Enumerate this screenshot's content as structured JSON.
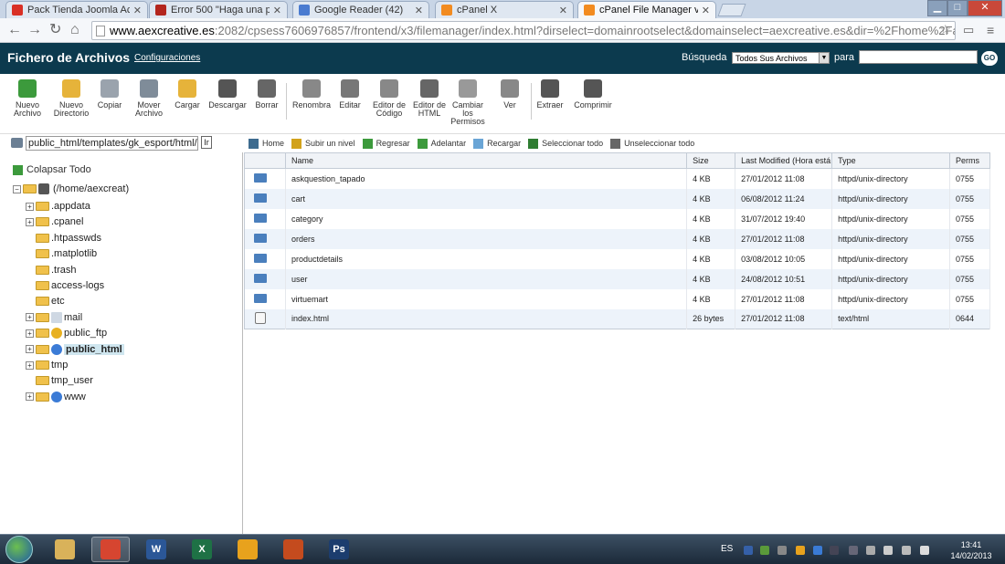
{
  "browser": {
    "tabs": [
      {
        "title": "Pack Tienda Joomla Activ",
        "icon": "gmail-icon",
        "active": false
      },
      {
        "title": "Error 500 \"Haga una pregu",
        "icon": "foro-icon",
        "active": false
      },
      {
        "title": "Google Reader (42)",
        "icon": "reader-icon",
        "active": false
      },
      {
        "title": "cPanel X",
        "icon": "cpanel-icon",
        "active": false
      },
      {
        "title": "cPanel File Manager v3",
        "icon": "cpanel-icon",
        "active": true
      }
    ],
    "url_host": "www.aexcreative.es",
    "url_rest": ":2082/cpsess7606976857/frontend/x3/filemanager/index.html?dirselect=domainrootselect&domainselect=aexcreative.es&dir=%2Fhome%2Faexcreat%"
  },
  "header": {
    "title": "Fichero de Archivos",
    "config_link": "Configuraciones",
    "search_label": "Búsqueda",
    "search_scope": "Todos Sus Archivos",
    "para_label": "para",
    "go_label": "GO"
  },
  "toolbar": [
    {
      "label": "Nuevo Archivo",
      "icon": "new-file-icon",
      "color": "#3c9a3c"
    },
    {
      "label": "Nuevo Directorio",
      "icon": "new-folder-icon",
      "color": "#e6b33a"
    },
    {
      "label": "Copiar",
      "icon": "copy-icon",
      "color": "#9aa3ad"
    },
    {
      "label": "Mover Archivo",
      "icon": "move-icon",
      "color": "#7f8c99"
    },
    {
      "label": "Cargar",
      "icon": "upload-icon",
      "color": "#e6b33a"
    },
    {
      "label": "Descargar",
      "icon": "download-icon",
      "color": "#555555"
    },
    {
      "label": "Borrar",
      "icon": "delete-icon",
      "color": "#666666"
    },
    {
      "label": "Renombra",
      "icon": "rename-icon",
      "color": "#888888"
    },
    {
      "label": "Editar",
      "icon": "edit-icon",
      "color": "#777777"
    },
    {
      "label": "Editor de Código",
      "icon": "code-editor-icon",
      "color": "#888888"
    },
    {
      "label": "Editor de HTML",
      "icon": "html-editor-icon",
      "color": "#666666"
    },
    {
      "label": "Cambiar los Permisos",
      "icon": "permissions-icon",
      "color": "#999999"
    },
    {
      "label": "Ver",
      "icon": "view-icon",
      "color": "#888888"
    },
    {
      "label": "Extraer",
      "icon": "extract-icon",
      "color": "#555555"
    },
    {
      "label": "Comprimir",
      "icon": "compress-icon",
      "color": "#555555"
    }
  ],
  "path": "public_html/templates/gk_esport/html/c",
  "actions": [
    {
      "label": "Home",
      "icon": "home-icon"
    },
    {
      "label": "Subir un nivel",
      "icon": "up-level-icon"
    },
    {
      "label": "Regresar",
      "icon": "back-icon"
    },
    {
      "label": "Adelantar",
      "icon": "forward-icon"
    },
    {
      "label": "Recargar",
      "icon": "reload-icon"
    },
    {
      "label": "Seleccionar todo",
      "icon": "select-all-icon"
    },
    {
      "label": "Unseleccionar todo",
      "icon": "unselect-all-icon"
    }
  ],
  "tree": {
    "collapse_label": "Colapsar Todo",
    "root": "(/home/aexcreat)",
    "items": [
      {
        "label": ".appdata",
        "expandable": true,
        "kind": "folder"
      },
      {
        "label": ".cpanel",
        "expandable": true,
        "kind": "folder"
      },
      {
        "label": ".htpasswds",
        "expandable": false,
        "kind": "folder"
      },
      {
        "label": ".matplotlib",
        "expandable": false,
        "kind": "folder"
      },
      {
        "label": ".trash",
        "expandable": false,
        "kind": "folder"
      },
      {
        "label": "access-logs",
        "expandable": false,
        "kind": "folder"
      },
      {
        "label": "etc",
        "expandable": false,
        "kind": "folder"
      },
      {
        "label": "mail",
        "expandable": true,
        "kind": "mail"
      },
      {
        "label": "public_ftp",
        "expandable": true,
        "kind": "ftp"
      },
      {
        "label": "public_html",
        "expandable": true,
        "kind": "globe",
        "selected": true
      },
      {
        "label": "tmp",
        "expandable": true,
        "kind": "folder"
      },
      {
        "label": "tmp_user",
        "expandable": false,
        "kind": "folder"
      },
      {
        "label": "www",
        "expandable": true,
        "kind": "globe"
      }
    ]
  },
  "files": {
    "columns": [
      "Name",
      "Size",
      "Last Modified (Hora está",
      "Type",
      "Perms"
    ],
    "rows": [
      {
        "name": "askquestion_tapado",
        "size": "4 KB",
        "modified": "27/01/2012 11:08",
        "type": "httpd/unix-directory",
        "perms": "0755",
        "kind": "folder"
      },
      {
        "name": "cart",
        "size": "4 KB",
        "modified": "06/08/2012 11:24",
        "type": "httpd/unix-directory",
        "perms": "0755",
        "kind": "folder"
      },
      {
        "name": "category",
        "size": "4 KB",
        "modified": "31/07/2012 19:40",
        "type": "httpd/unix-directory",
        "perms": "0755",
        "kind": "folder"
      },
      {
        "name": "orders",
        "size": "4 KB",
        "modified": "27/01/2012 11:08",
        "type": "httpd/unix-directory",
        "perms": "0755",
        "kind": "folder"
      },
      {
        "name": "productdetails",
        "size": "4 KB",
        "modified": "03/08/2012 10:05",
        "type": "httpd/unix-directory",
        "perms": "0755",
        "kind": "folder"
      },
      {
        "name": "user",
        "size": "4 KB",
        "modified": "24/08/2012 10:51",
        "type": "httpd/unix-directory",
        "perms": "0755",
        "kind": "folder"
      },
      {
        "name": "virtuemart",
        "size": "4 KB",
        "modified": "27/01/2012 11:08",
        "type": "httpd/unix-directory",
        "perms": "0755",
        "kind": "folder"
      },
      {
        "name": "index.html",
        "size": "26 bytes",
        "modified": "27/01/2012 11:08",
        "type": "text/html",
        "perms": "0644",
        "kind": "file"
      }
    ]
  },
  "taskbar": {
    "apps": [
      {
        "icon": "explorer-icon",
        "letter": "",
        "color": "#d9b25a"
      },
      {
        "icon": "chrome-icon",
        "letter": "",
        "color": "#d64530"
      },
      {
        "icon": "word-icon",
        "letter": "W",
        "color": "#2b5797"
      },
      {
        "icon": "excel-icon",
        "letter": "X",
        "color": "#1e7145"
      },
      {
        "icon": "outlook-icon",
        "letter": "",
        "color": "#e8a21d"
      },
      {
        "icon": "firefox-icon",
        "letter": "",
        "color": "#c44b1e"
      },
      {
        "icon": "photoshop-icon",
        "letter": "Ps",
        "color": "#1c3d6e"
      }
    ],
    "lang": "ES",
    "time": "13:41",
    "date": "14/02/2013"
  }
}
